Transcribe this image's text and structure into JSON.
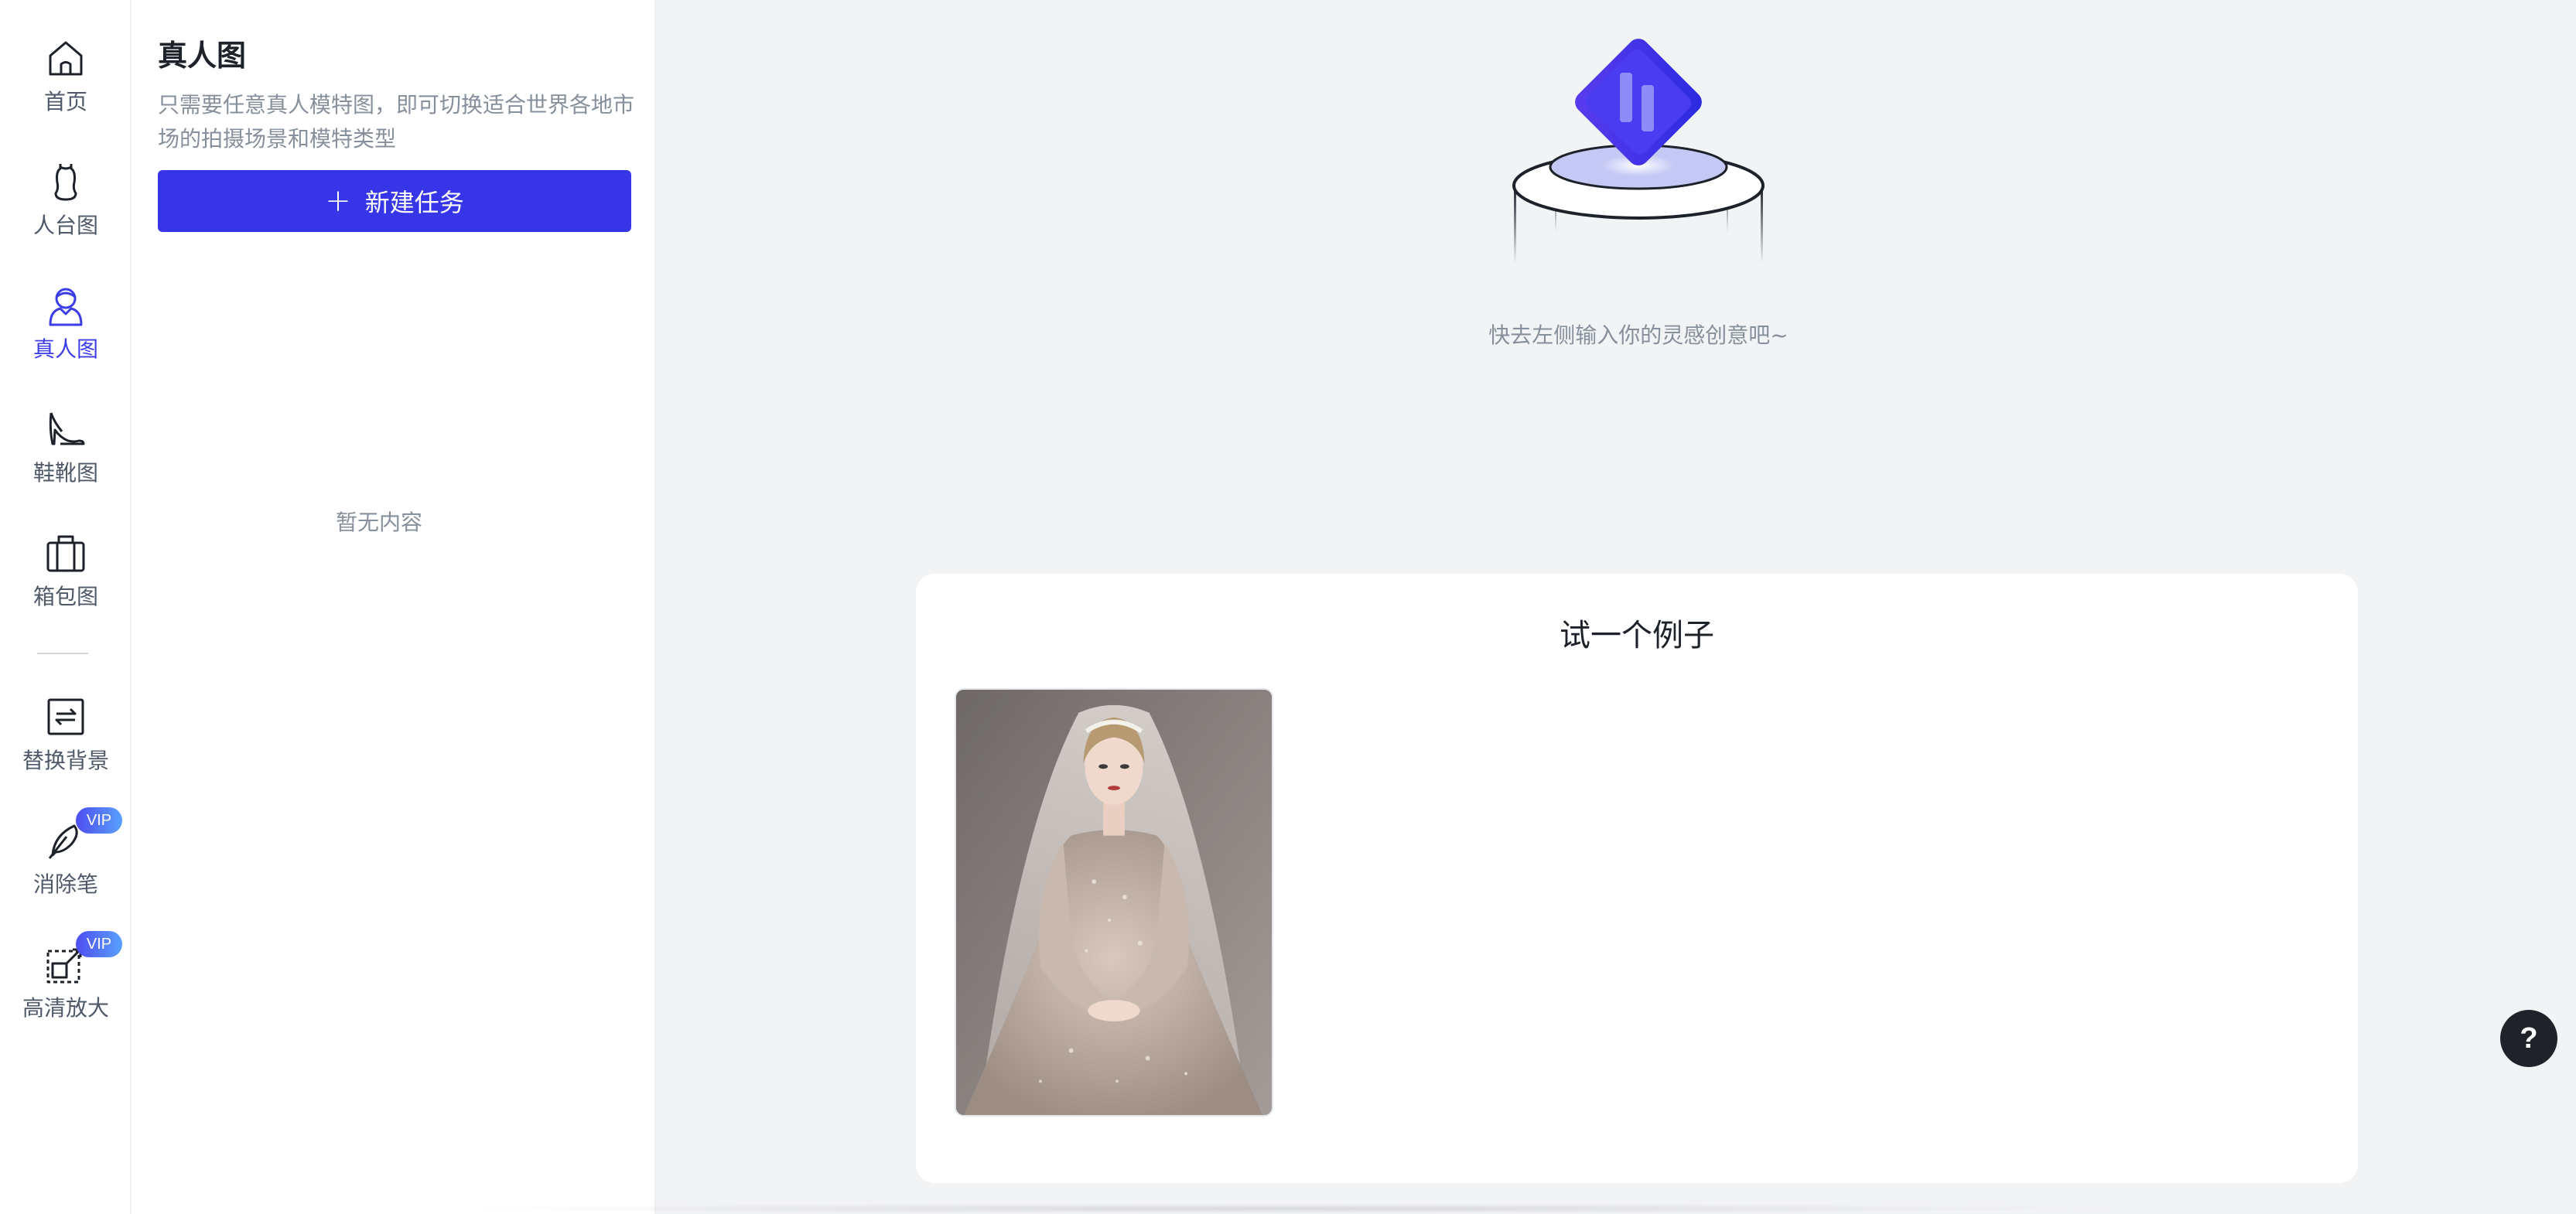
{
  "nav": {
    "items": [
      {
        "label": "首页",
        "icon": "home-icon"
      },
      {
        "label": "人台图",
        "icon": "mannequin-icon"
      },
      {
        "label": "真人图",
        "icon": "person-icon",
        "active": true
      },
      {
        "label": "鞋靴图",
        "icon": "high-heel-icon"
      },
      {
        "label": "箱包图",
        "icon": "suitcase-icon"
      },
      {
        "label": "替换背景",
        "icon": "swap-background-icon"
      },
      {
        "label": "消除笔",
        "icon": "eraser-pen-icon",
        "badge": "VIP"
      },
      {
        "label": "高清放大",
        "icon": "upscale-icon",
        "badge": "VIP"
      }
    ]
  },
  "panel": {
    "title": "真人图",
    "description": "只需要任意真人模特图，即可切换适合世界各地市场的拍摄场景和模特类型",
    "new_task_label": "新建任务",
    "empty_text": "暂无内容"
  },
  "main": {
    "hint": "快去左侧输入你的灵感创意吧~",
    "example": {
      "title": "试一个例子",
      "image_alt": "wedding dress model photo"
    },
    "help_label": "?"
  },
  "colors": {
    "accent": "#3636e8",
    "active_nav": "#3d3de8",
    "muted_text": "#86909c",
    "background": "#f2f3f5"
  }
}
